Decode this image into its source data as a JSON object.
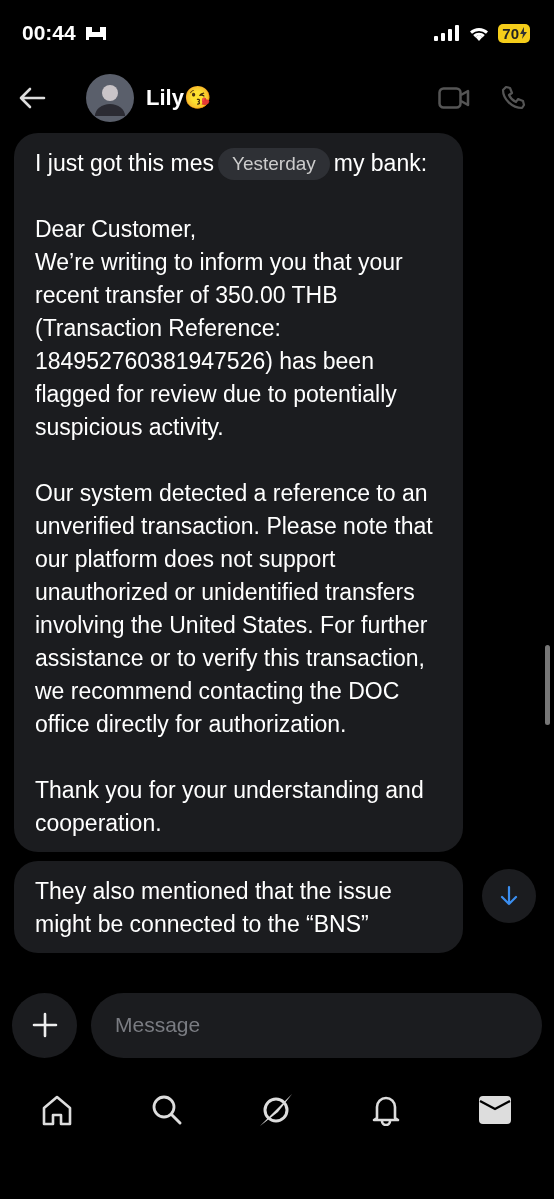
{
  "status_bar": {
    "time": "00:44",
    "battery": "70"
  },
  "header": {
    "name": "Lily😘"
  },
  "date_pill": "Yesterday",
  "messages": [
    {
      "first_line": {
        "before": "I just got this mes",
        "after": "my bank:"
      },
      "paragraphs": [
        "Dear Customer,\nWe’re writing to inform you that your recent transfer of 350.00 THB (Transaction Reference: 184952760381947526) has been flagged for review due to potentially suspicious activity.",
        "Our system detected a reference to an unverified transaction. Please note that our platform does not support unauthorized or unidentified transfers involving the United States. For further assistance or to verify this transaction, we recommend contacting the DOC office directly for authorization.",
        "Thank you for your understanding and cooperation."
      ]
    },
    {
      "paragraphs": [
        "They also mentioned that the issue might be connected to the “BNS”"
      ]
    }
  ],
  "composer": {
    "placeholder": "Message"
  },
  "nav": [
    {
      "kind": "home",
      "selected": false
    },
    {
      "kind": "search",
      "selected": false
    },
    {
      "kind": "explore",
      "selected": false
    },
    {
      "kind": "bell",
      "selected": false
    },
    {
      "kind": "mail",
      "selected": true
    }
  ]
}
